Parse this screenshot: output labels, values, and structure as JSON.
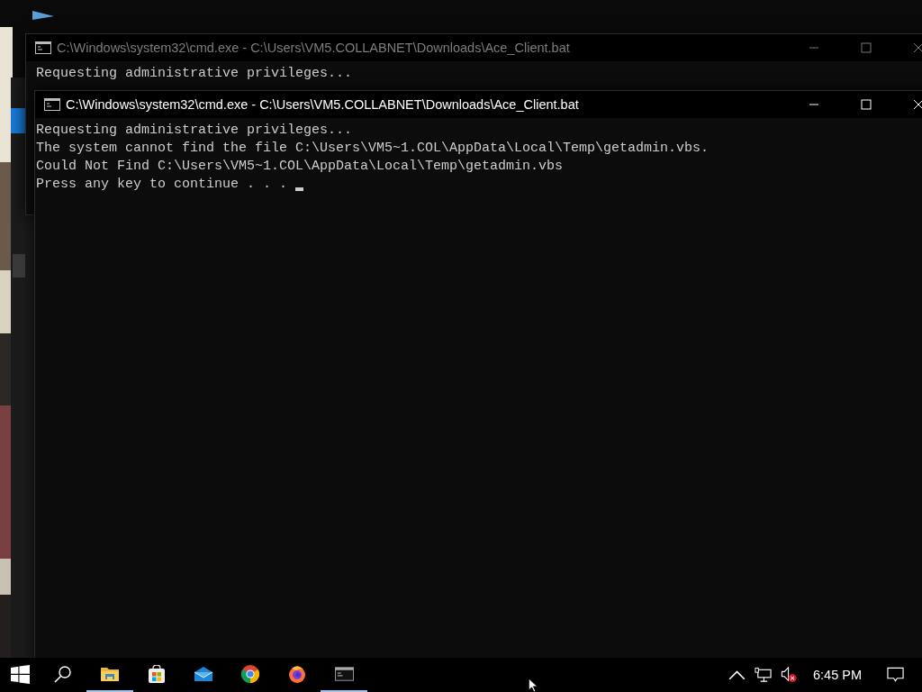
{
  "windows": [
    {
      "title": "C:\\Windows\\system32\\cmd.exe - C:\\Users\\VM5.COLLABNET\\Downloads\\Ace_Client.bat",
      "active": false,
      "cursor": false,
      "lines": [
        "Requesting administrative privileges..."
      ]
    },
    {
      "title": "C:\\Windows\\system32\\cmd.exe - C:\\Users\\VM5.COLLABNET\\Downloads\\Ace_Client.bat",
      "active": true,
      "cursor": true,
      "lines": [
        "Requesting administrative privileges...",
        "The system cannot find the file C:\\Users\\VM5~1.COL\\AppData\\Local\\Temp\\getadmin.vbs.",
        "Could Not Find C:\\Users\\VM5~1.COL\\AppData\\Local\\Temp\\getadmin.vbs",
        "Press any key to continue . . ."
      ]
    }
  ],
  "taskbar": {
    "apps": [
      {
        "kind": "start",
        "running": false
      },
      {
        "kind": "search",
        "running": false
      },
      {
        "kind": "explorer",
        "running": true
      },
      {
        "kind": "store",
        "running": false
      },
      {
        "kind": "mail",
        "running": false
      },
      {
        "kind": "chrome",
        "running": false
      },
      {
        "kind": "firefox",
        "running": false
      },
      {
        "kind": "console",
        "running": true
      }
    ],
    "tray": {
      "volume_muted": true,
      "clock": "6:45 PM"
    }
  }
}
